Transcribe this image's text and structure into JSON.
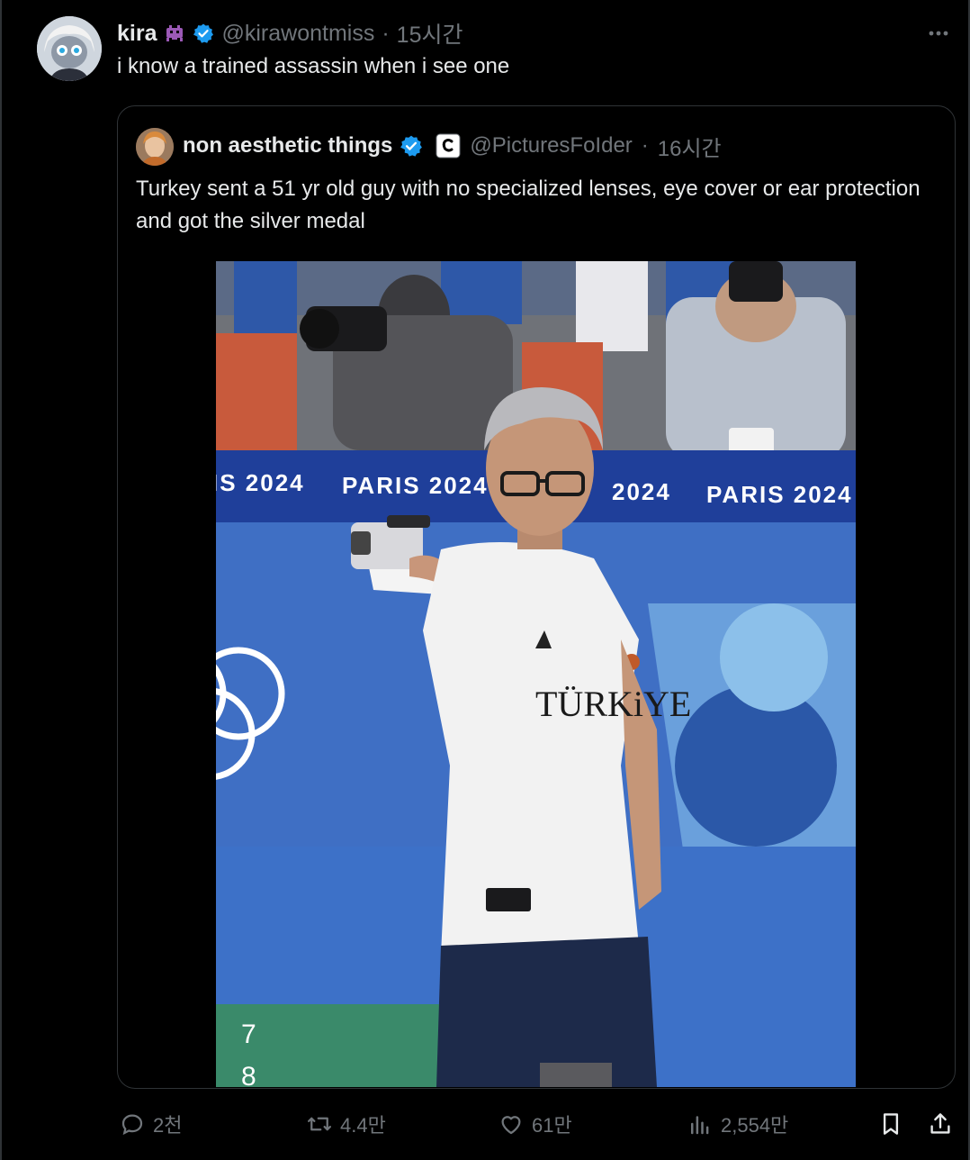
{
  "tweet": {
    "display_name": "kira",
    "handle": "@kirawontmiss",
    "separator": "·",
    "time": "15시간",
    "text": "i know a trained assassin when i see one"
  },
  "quote": {
    "display_name": "non aesthetic things",
    "handle": "@PicturesFoIder",
    "separator": "·",
    "time": "16시간",
    "text": "Turkey sent a 51 yr old guy with no specialized lenses, eye cover or ear protection and got the silver medal",
    "media": {
      "banner_texts": [
        "IS 2024",
        "PARIS 2024",
        "2024",
        "PARIS 2024"
      ],
      "shirt_text": "TÜRKiYE",
      "lane_numbers": [
        "7",
        "8"
      ]
    }
  },
  "actions": {
    "replies": "2천",
    "reposts": "4.4만",
    "likes": "61만",
    "views": "2,554만"
  },
  "icons": [
    "alien-emoji-icon",
    "verified-badge-icon",
    "more-options-icon",
    "corp-affiliate-icon",
    "reply-icon",
    "repost-icon",
    "like-icon",
    "views-icon",
    "bookmark-icon",
    "share-icon"
  ],
  "colors": {
    "background": "#000000",
    "text": "#e7e9ea",
    "muted": "#71767b",
    "verified": "#1d9bf0",
    "border": "#2f3336"
  }
}
